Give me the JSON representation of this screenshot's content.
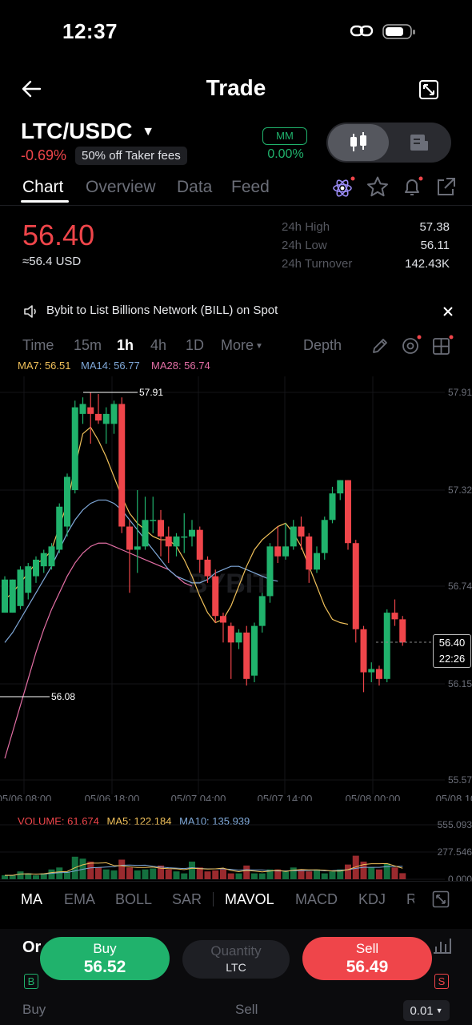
{
  "status_bar": {
    "time": "12:37"
  },
  "header": {
    "title": "Trade"
  },
  "pair": {
    "symbol": "LTC/USDC",
    "change": "-0.69%",
    "promo": "50% off Taker fees",
    "mm_label": "MM",
    "mm_value": "0.00%"
  },
  "tabs": [
    "Chart",
    "Overview",
    "Data",
    "Feed"
  ],
  "ticker": {
    "last_price": "56.40",
    "usd_equiv": "≈56.4 USD",
    "stats": [
      {
        "label": "24h High",
        "value": "57.38"
      },
      {
        "label": "24h Low",
        "value": "56.11"
      },
      {
        "label": "24h Turnover",
        "value": "142.43K"
      }
    ]
  },
  "announcement": {
    "text": "Bybit to List Billions Network (BILL) on  Spot"
  },
  "timeframes": {
    "items": [
      "Time",
      "15m",
      "1h",
      "4h",
      "1D",
      "More"
    ],
    "active": "1h",
    "depth_label": "Depth"
  },
  "ma_legend": {
    "ma7": "MA7: 56.51",
    "ma14": "MA14: 56.77",
    "ma28": "MA28: 56.74"
  },
  "chart_data": {
    "type": "candlestick",
    "interval": "1h",
    "y_axis_labels": [
      "57.91",
      "57.32",
      "56.74",
      "56.15",
      "55.57"
    ],
    "ylim": [
      55.57,
      57.91
    ],
    "x_axis_labels": [
      "05/06 08:00",
      "05/06 18:00",
      "05/07 04:00",
      "05/07 14:00",
      "05/08 00:00",
      "05/08 10"
    ],
    "high_marker": "57.91",
    "low_marker": "56.08",
    "current_price": "56.40",
    "countdown": "22:26",
    "candles": [
      [
        56.58,
        56.78,
        56.58,
        56.8
      ],
      [
        56.58,
        56.78,
        56.58,
        56.78
      ],
      [
        56.62,
        56.84,
        56.6,
        56.86
      ],
      [
        56.7,
        56.86,
        56.66,
        56.88
      ],
      [
        56.8,
        56.9,
        56.76,
        56.92
      ],
      [
        56.86,
        56.94,
        56.82,
        56.96
      ],
      [
        56.86,
        56.98,
        56.84,
        57.0
      ],
      [
        56.96,
        57.22,
        56.94,
        57.24
      ],
      [
        57.1,
        57.4,
        57.04,
        57.42
      ],
      [
        57.32,
        57.82,
        57.3,
        57.86
      ],
      [
        57.78,
        57.84,
        57.72,
        57.88
      ],
      [
        57.82,
        57.78,
        57.6,
        57.91
      ],
      [
        57.78,
        57.74,
        57.72,
        57.9
      ],
      [
        57.72,
        57.78,
        57.6,
        57.82
      ],
      [
        57.72,
        57.84,
        57.66,
        57.86
      ],
      [
        57.84,
        57.1,
        57.06,
        57.88
      ],
      [
        57.1,
        56.96,
        56.7,
        57.14
      ],
      [
        56.96,
        56.98,
        56.82,
        57.32
      ],
      [
        56.98,
        57.14,
        56.96,
        57.28
      ],
      [
        57.14,
        57.14,
        57.06,
        57.28
      ],
      [
        57.14,
        57.04,
        56.92,
        57.2
      ],
      [
        57.04,
        56.98,
        56.88,
        57.1
      ],
      [
        56.98,
        57.04,
        56.92,
        57.06
      ],
      [
        57.04,
        57.04,
        56.94,
        57.18
      ],
      [
        57.04,
        57.08,
        56.98,
        57.14
      ],
      [
        57.08,
        56.9,
        56.82,
        57.1
      ],
      [
        56.9,
        56.8,
        56.76,
        56.92
      ],
      [
        56.8,
        56.56,
        56.52,
        56.84
      ],
      [
        56.56,
        56.52,
        56.4,
        56.58
      ],
      [
        56.5,
        56.4,
        56.18,
        56.52
      ],
      [
        56.4,
        56.46,
        56.36,
        56.48
      ],
      [
        56.46,
        56.18,
        56.14,
        56.5
      ],
      [
        56.2,
        56.5,
        56.16,
        56.52
      ],
      [
        56.5,
        56.68,
        56.46,
        56.7
      ],
      [
        56.68,
        56.98,
        56.64,
        57.0
      ],
      [
        56.98,
        56.92,
        56.88,
        57.1
      ],
      [
        56.92,
        56.98,
        56.9,
        57.12
      ],
      [
        56.98,
        57.1,
        56.96,
        57.14
      ],
      [
        57.1,
        57.04,
        56.96,
        57.16
      ],
      [
        57.04,
        56.84,
        56.76,
        57.06
      ],
      [
        56.84,
        56.94,
        56.82,
        56.98
      ],
      [
        56.94,
        57.14,
        56.9,
        57.16
      ],
      [
        57.14,
        57.3,
        57.12,
        57.34
      ],
      [
        57.3,
        57.38,
        57.26,
        57.38
      ],
      [
        57.38,
        57.0,
        56.96,
        57.38
      ],
      [
        57.0,
        56.48,
        56.4,
        57.02
      ],
      [
        56.48,
        56.22,
        56.1,
        56.5
      ],
      [
        56.22,
        56.24,
        56.16,
        56.28
      ],
      [
        56.24,
        56.18,
        56.14,
        56.26
      ],
      [
        56.18,
        56.58,
        56.16,
        56.6
      ],
      [
        56.58,
        56.54,
        56.5,
        56.66
      ],
      [
        56.54,
        56.4,
        56.38,
        56.56
      ]
    ],
    "ma7": [
      56.66,
      56.7,
      56.76,
      56.82,
      56.88,
      56.9,
      56.96,
      57.1,
      57.24,
      57.46,
      57.66,
      57.7,
      57.62,
      57.52,
      57.4,
      57.28,
      57.18,
      57.12,
      57.08,
      57.04,
      57.02,
      57.02,
      56.98,
      56.9,
      56.8,
      56.68,
      56.58,
      56.52,
      56.54,
      56.62,
      56.74,
      56.86,
      56.96,
      57.02,
      57.06,
      57.1,
      57.12,
      57.06,
      56.98,
      56.86,
      56.74,
      56.62,
      56.54,
      56.52,
      56.51
    ],
    "ma14": [
      56.4,
      56.46,
      56.54,
      56.62,
      56.7,
      56.78,
      56.86,
      56.96,
      57.06,
      57.14,
      57.2,
      57.24,
      57.26,
      57.26,
      57.24,
      57.2,
      57.14,
      57.08,
      57.02,
      56.96,
      56.9,
      56.84,
      56.8,
      56.78,
      56.76,
      56.76,
      56.78,
      56.82,
      56.84,
      56.86,
      56.86,
      56.84,
      56.82,
      56.8,
      56.78,
      56.77
    ],
    "ma28": [
      55.7,
      55.86,
      56.02,
      56.18,
      56.34,
      56.48,
      56.6,
      56.7,
      56.8,
      56.88,
      56.94,
      56.98,
      57.0,
      57.0,
      56.98,
      56.96,
      56.94,
      56.92,
      56.9,
      56.88,
      56.86,
      56.84,
      56.8,
      56.76,
      56.74
    ],
    "volume": {
      "legend_volume": "VOLUME: 61.674",
      "legend_ma5": "MA5: 122.184",
      "legend_ma10": "MA10: 135.939",
      "y_labels": [
        "555.093",
        "277.546",
        "0.000"
      ],
      "bars": [
        40,
        40,
        80,
        60,
        40,
        60,
        100,
        120,
        80,
        230,
        210,
        180,
        120,
        100,
        90,
        200,
        120,
        90,
        100,
        110,
        140,
        100,
        80,
        60,
        180,
        120,
        80,
        90,
        100,
        60,
        60,
        140,
        60,
        60,
        100,
        100,
        80,
        120,
        100,
        80,
        100,
        60,
        80,
        100,
        150,
        240,
        180,
        120,
        100,
        160,
        120,
        62
      ]
    }
  },
  "indicators": {
    "main": [
      "MA",
      "EMA",
      "BOLL",
      "SAR"
    ],
    "sub": [
      "MAVOL",
      "MACD",
      "KDJ",
      "R"
    ]
  },
  "order_bar": {
    "buy_label": "Buy",
    "buy_price": "56.52",
    "qty_label": "Quantity",
    "qty_unit": "LTC",
    "sell_label": "Sell",
    "sell_price": "56.49",
    "bottom_buy": "Buy",
    "bottom_sell": "Sell",
    "precision": "0.01",
    "or_fragment": "Or",
    "b_badge": "B",
    "s_badge": "S"
  },
  "colors": {
    "up": "#20b26c",
    "down": "#ef454a",
    "ma7": "#f0c05a",
    "ma14": "#7fa8d8",
    "ma28": "#e36fa5"
  }
}
